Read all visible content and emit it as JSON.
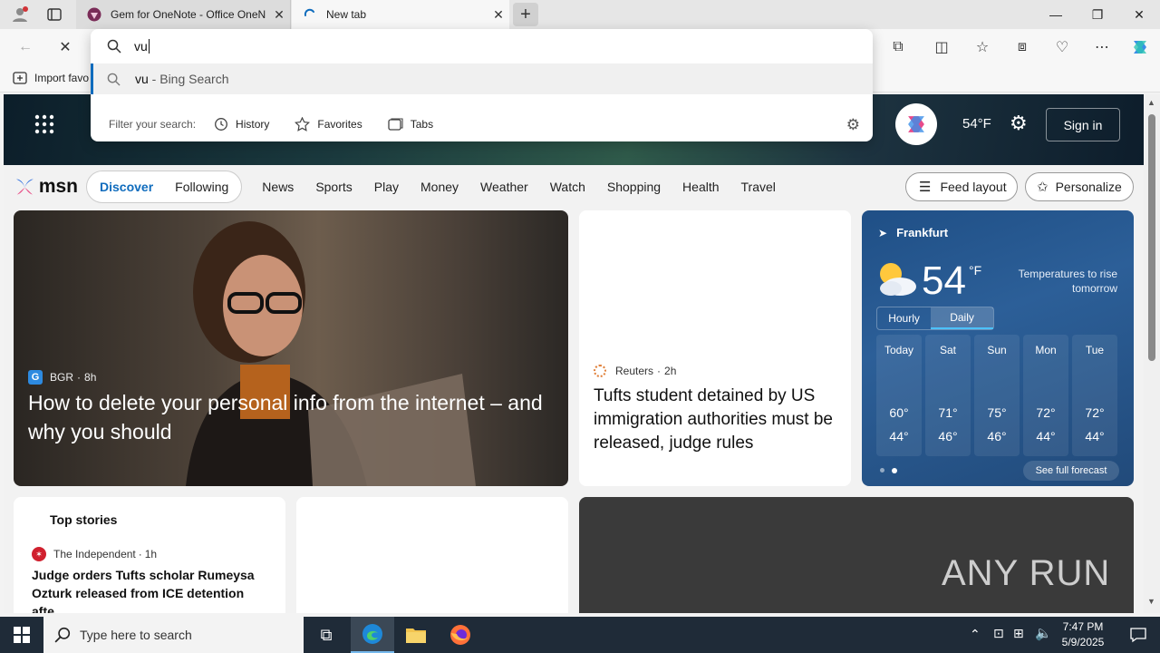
{
  "tabs": [
    {
      "title": "Gem for OneNote - Office OneN",
      "active": false
    },
    {
      "title": "New tab",
      "active": true
    }
  ],
  "omnibox": {
    "value": "vu",
    "suggestion_query": "vu",
    "suggestion_source": " - Bing Search",
    "filter_label": "Filter your search:",
    "filters": [
      "History",
      "Favorites",
      "Tabs"
    ]
  },
  "favorites_bar": {
    "import_label": "Import favo"
  },
  "msn": {
    "logo": "msn",
    "temp": "54°F",
    "sign_in": "Sign in",
    "pivot_tabs": [
      "Discover",
      "Following"
    ],
    "nav": [
      "News",
      "Sports",
      "Play",
      "Money",
      "Weather",
      "Watch",
      "Shopping",
      "Health",
      "Travel"
    ],
    "feed_layout": "Feed layout",
    "personalize": "Personalize"
  },
  "hero_story": {
    "source": "BGR",
    "age": "8h",
    "headline": "How to delete your personal info from the internet – and why you should"
  },
  "reuters_story": {
    "source": "Reuters",
    "age": "2h",
    "headline": "Tufts student detained by US immigration authorities must be released, judge rules"
  },
  "weather": {
    "city": "Frankfurt",
    "temp": "54",
    "unit": "°F",
    "note": "Temperatures to rise tomorrow",
    "tabs": [
      "Hourly",
      "Daily"
    ],
    "days": [
      {
        "day": "Today",
        "hi": "60°",
        "lo": "44°"
      },
      {
        "day": "Sat",
        "hi": "71°",
        "lo": "46°"
      },
      {
        "day": "Sun",
        "hi": "75°",
        "lo": "46°"
      },
      {
        "day": "Mon",
        "hi": "72°",
        "lo": "44°"
      },
      {
        "day": "Tue",
        "hi": "72°",
        "lo": "44°"
      }
    ],
    "forecast_link": "See full forecast"
  },
  "top_stories": {
    "title": "Top stories",
    "source": "The Independent",
    "age": "1h",
    "headline": "Judge orders Tufts scholar Rumeysa Ozturk released from ICE detention afte..."
  },
  "watermark": "ANY RUN",
  "taskbar": {
    "search_placeholder": "Type here to search",
    "time": "7:47 PM",
    "date": "5/9/2025"
  },
  "colors": {
    "accent": "#0f6cbd",
    "taskbar": "#1f2b38"
  }
}
